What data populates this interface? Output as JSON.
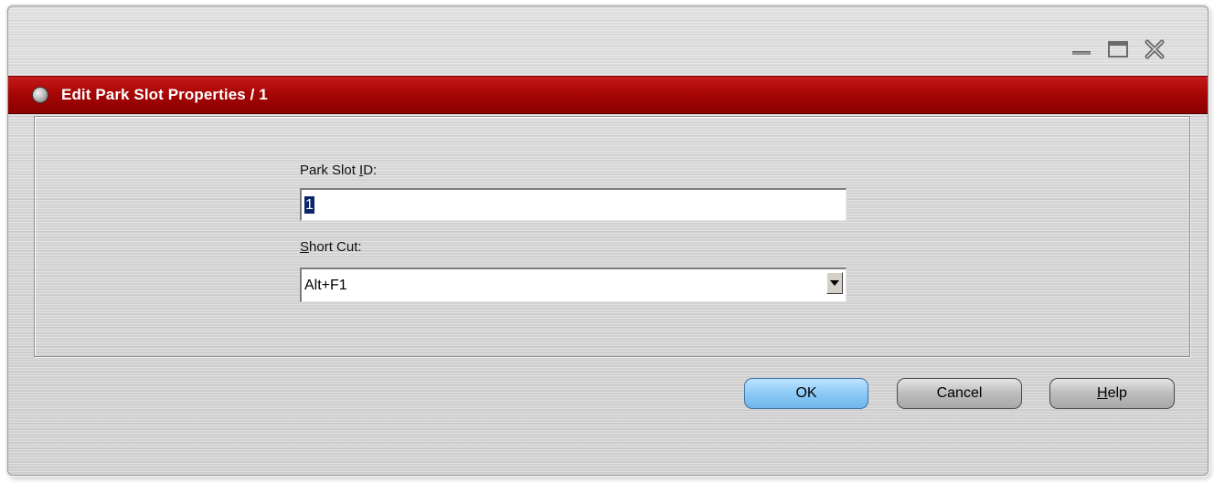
{
  "window": {
    "title": "Edit Park Slot Properties / 1",
    "controls": {
      "minimize_icon": "minimize-icon",
      "maximize_icon": "maximize-icon",
      "close_icon": "close-icon"
    },
    "title_bar_color": "#a80606"
  },
  "form": {
    "park_slot_id": {
      "label_prefix": "Park Slot ",
      "label_mnemonic": "I",
      "label_suffix": "D:",
      "value": "1"
    },
    "short_cut": {
      "label_mnemonic": "S",
      "label_suffix": "hort Cut:",
      "selected_value": "Alt+F1",
      "arrow_icon": "chevron-down-icon"
    }
  },
  "buttons": {
    "ok_label": "OK",
    "cancel_label": "Cancel",
    "help_mnemonic": "H",
    "help_suffix": "elp",
    "ok_color": "#8ccaf6"
  }
}
